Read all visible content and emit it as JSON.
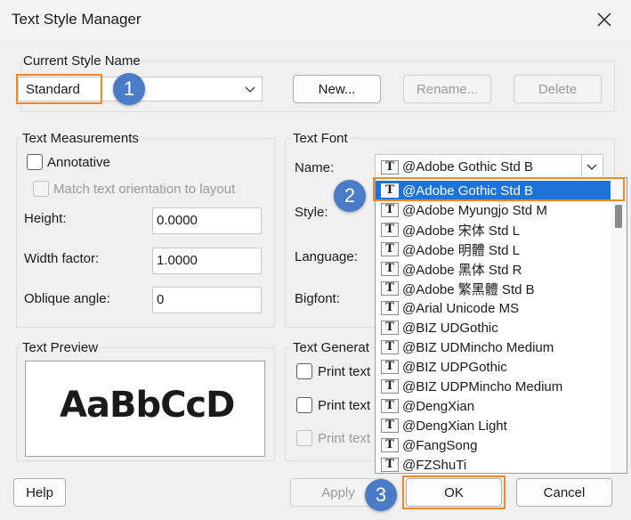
{
  "window": {
    "title": "Text Style Manager"
  },
  "current_style": {
    "group_label": "Current Style Name",
    "selected": "Standard",
    "new_label": "New...",
    "rename_label": "Rename...",
    "delete_label": "Delete"
  },
  "measurements": {
    "group_label": "Text Measurements",
    "annotative_label": "Annotative",
    "match_label": "Match text orientation to layout",
    "height_label": "Height:",
    "height_value": "0.0000",
    "width_label": "Width factor:",
    "width_value": "1.0000",
    "oblique_label": "Oblique angle:",
    "oblique_value": "0"
  },
  "font": {
    "group_label": "Text Font",
    "name_label": "Name:",
    "name_value": "@Adobe Gothic Std B",
    "style_label": "Style:",
    "language_label": "Language:",
    "bigfont_label": "Bigfont:",
    "options": [
      "@Adobe Gothic Std B",
      "@Adobe Myungjo Std M",
      "@Adobe 宋体 Std L",
      "@Adobe 明體 Std L",
      "@Adobe 黑体 Std R",
      "@Adobe 繁黑體 Std B",
      "@Arial Unicode MS",
      "@BIZ UDGothic",
      "@BIZ UDMincho Medium",
      "@BIZ UDPGothic",
      "@BIZ UDPMincho Medium",
      "@DengXian",
      "@DengXian Light",
      "@FangSong",
      "@FZShuTi"
    ]
  },
  "preview": {
    "group_label": "Text Preview",
    "sample": "AaBbCcD"
  },
  "generation": {
    "group_label": "Text Generat",
    "option1": "Print text",
    "option2": "Print text",
    "option3": "Print text"
  },
  "footer": {
    "help_label": "Help",
    "apply_label": "Apply",
    "ok_label": "OK",
    "cancel_label": "Cancel"
  },
  "callouts": {
    "one": "1",
    "two": "2",
    "three": "3"
  },
  "colors": {
    "highlight": "#ef8a2a",
    "badge": "#4a7bc7",
    "selection": "#1e73d8"
  },
  "icons": {
    "close": "close-icon",
    "font_type": "truetype-font-icon",
    "dropdown": "chevron-down-icon"
  }
}
